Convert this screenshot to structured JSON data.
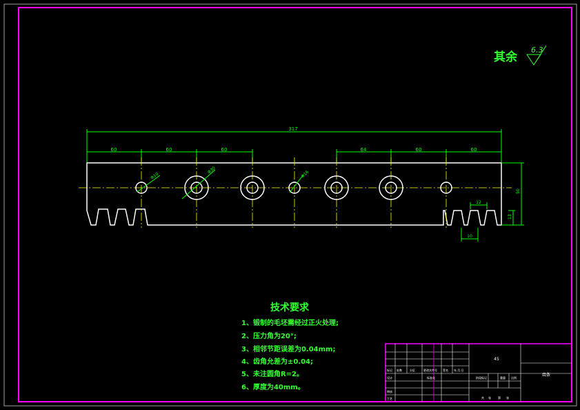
{
  "roughness_note": {
    "label": "其余",
    "value": "6.3"
  },
  "dimensions": {
    "overall": "317",
    "top_segments": [
      "60",
      "60",
      "60",
      "64",
      "60",
      "60"
    ],
    "hole_left_dia": "Φ10",
    "hole_big_dia": "Φ30",
    "hole_mid_dia": "Φ16",
    "height_total": "50",
    "height_tooth": "13",
    "tooth_pitch": "12",
    "tooth_base": "10"
  },
  "tech_requirements": {
    "title": "技术要求",
    "items": [
      "1、锻制的毛坯需经过正火处理;",
      "2、压力角为20°;",
      "3、相邻节距误差为0.04mm;",
      "4、齿角允差为±0.04;",
      "5、未注圆角R=2。",
      "6、厚度为40mm。"
    ]
  },
  "title_block": {
    "material": "45",
    "part_name": "齿条",
    "rows": [
      "标记",
      "设计",
      "审核",
      "工艺"
    ],
    "header_cells": [
      "处数",
      "分区",
      "更改文件号",
      "签名",
      "年.月.日"
    ],
    "sub_cells": [
      "标准化",
      "阶段标记",
      "重量",
      "比例"
    ],
    "bottom_cells": [
      "共",
      "张",
      "第",
      "张"
    ]
  },
  "colors": {
    "frame": "#ff00ff",
    "part": "#ffffff",
    "dimension": "#00ff00",
    "centerline": "#ffff00",
    "notes": "#33ff33"
  }
}
